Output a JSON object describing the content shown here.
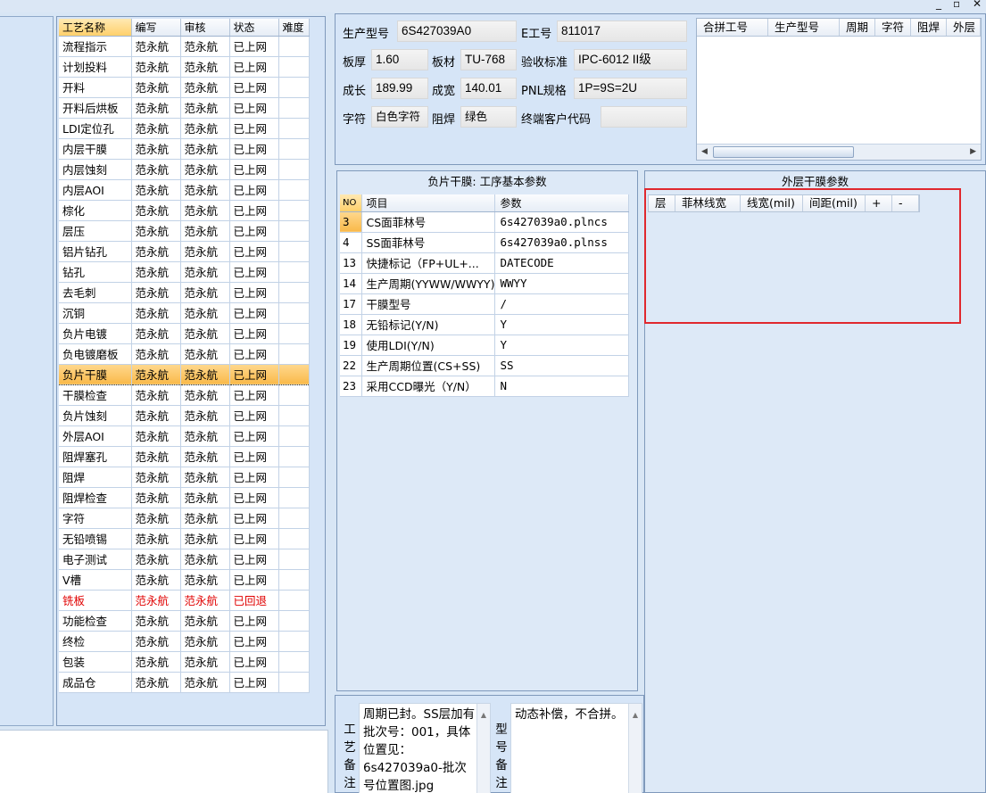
{
  "window_controls": {
    "minimize": "_",
    "restore": "▫",
    "close": "✕"
  },
  "process_list": {
    "headers": [
      "工艺名称",
      "编写",
      "审核",
      "状态",
      "难度"
    ],
    "rows": [
      [
        "流程指示",
        "范永航",
        "范永航",
        "已上网",
        ""
      ],
      [
        "计划投料",
        "范永航",
        "范永航",
        "已上网",
        ""
      ],
      [
        "开料",
        "范永航",
        "范永航",
        "已上网",
        ""
      ],
      [
        "开料后烘板",
        "范永航",
        "范永航",
        "已上网",
        ""
      ],
      [
        "LDI定位孔",
        "范永航",
        "范永航",
        "已上网",
        ""
      ],
      [
        "内层干膜",
        "范永航",
        "范永航",
        "已上网",
        ""
      ],
      [
        "内层蚀刻",
        "范永航",
        "范永航",
        "已上网",
        ""
      ],
      [
        "内层AOI",
        "范永航",
        "范永航",
        "已上网",
        ""
      ],
      [
        "棕化",
        "范永航",
        "范永航",
        "已上网",
        ""
      ],
      [
        "层压",
        "范永航",
        "范永航",
        "已上网",
        ""
      ],
      [
        "铝片钻孔",
        "范永航",
        "范永航",
        "已上网",
        ""
      ],
      [
        "钻孔",
        "范永航",
        "范永航",
        "已上网",
        ""
      ],
      [
        "去毛刺",
        "范永航",
        "范永航",
        "已上网",
        ""
      ],
      [
        "沉铜",
        "范永航",
        "范永航",
        "已上网",
        ""
      ],
      [
        "负片电镀",
        "范永航",
        "范永航",
        "已上网",
        ""
      ],
      [
        "负电镀磨板",
        "范永航",
        "范永航",
        "已上网",
        ""
      ],
      [
        "负片干膜",
        "范永航",
        "范永航",
        "已上网",
        ""
      ],
      [
        "干膜检查",
        "范永航",
        "范永航",
        "已上网",
        ""
      ],
      [
        "负片蚀刻",
        "范永航",
        "范永航",
        "已上网",
        ""
      ],
      [
        "外层AOI",
        "范永航",
        "范永航",
        "已上网",
        ""
      ],
      [
        "阻焊塞孔",
        "范永航",
        "范永航",
        "已上网",
        ""
      ],
      [
        "阻焊",
        "范永航",
        "范永航",
        "已上网",
        ""
      ],
      [
        "阻焊检查",
        "范永航",
        "范永航",
        "已上网",
        ""
      ],
      [
        "字符",
        "范永航",
        "范永航",
        "已上网",
        ""
      ],
      [
        "无铅喷锡",
        "范永航",
        "范永航",
        "已上网",
        ""
      ],
      [
        "电子测试",
        "范永航",
        "范永航",
        "已上网",
        ""
      ],
      [
        "V槽",
        "范永航",
        "范永航",
        "已上网",
        ""
      ],
      [
        "铣板",
        "范永航",
        "范永航",
        "已回退",
        ""
      ],
      [
        "功能检查",
        "范永航",
        "范永航",
        "已上网",
        ""
      ],
      [
        "终检",
        "范永航",
        "范永航",
        "已上网",
        ""
      ],
      [
        "包装",
        "范永航",
        "范永航",
        "已上网",
        ""
      ],
      [
        "成品仓",
        "范永航",
        "范永航",
        "已上网",
        ""
      ]
    ]
  },
  "info": {
    "model_label": "生产型号",
    "model_value": "6S427039A0",
    "e_label": "E工号",
    "e_value": "811017",
    "thickness_label": "板厚",
    "thickness_value": "1.60",
    "material_label": "板材",
    "material_value": "TU-768",
    "standard_label": "验收标准",
    "standard_value": "IPC-6012 II级",
    "length_label": "成长",
    "length_value": "189.99",
    "width_label": "成宽",
    "width_value": "140.01",
    "pnl_label": "PNL规格",
    "pnl_value": "1P=9S=2U",
    "char_label": "字符",
    "char_value": "白色字符",
    "mask_label": "阻焊",
    "mask_value": "绿色",
    "customer_label": "终端客户代码",
    "customer_value": ""
  },
  "combine_table": {
    "headers": [
      "合拼工号",
      "生产型号",
      "周期",
      "字符",
      "阻焊",
      "外层"
    ]
  },
  "params": {
    "title": "负片干膜: 工序基本参数",
    "headers": [
      "NO",
      "项目",
      "参数"
    ],
    "rows": [
      [
        "3",
        "CS面菲林号",
        "6s427039a0.plncs"
      ],
      [
        "4",
        "SS面菲林号",
        "6s427039a0.plnss"
      ],
      [
        "13",
        "快捷标记（FP+UL+...",
        "DATECODE"
      ],
      [
        "14",
        "生产周期(YYWW/WWYY)",
        "WWYY"
      ],
      [
        "17",
        "干膜型号",
        "/"
      ],
      [
        "18",
        "无铅标记(Y/N)",
        "Y"
      ],
      [
        "19",
        "使用LDI(Y/N)",
        "Y"
      ],
      [
        "22",
        "生产周期位置(CS+SS)",
        "SS"
      ],
      [
        "23",
        "采用CCD曝光（Y/N）",
        "N"
      ]
    ]
  },
  "outer": {
    "title": "外层干膜参数",
    "headers": [
      "层",
      "菲林线宽",
      "线宽(mil)",
      "间距(mil)",
      "+",
      "-"
    ]
  },
  "notes": {
    "process_label": [
      "工",
      "艺",
      "备",
      "注"
    ],
    "process_text": "周期已封。SS层加有批次号：001，具体位置见：6s427039a0-批次号位置图.jpg",
    "model_label": [
      "型",
      "号",
      "备",
      "注"
    ],
    "model_text": "动态补偿，不合拼。"
  },
  "colors": {
    "selection": "#f9b94a",
    "returned": "#e00000",
    "highlight_box": "#e0282e",
    "panel_bg": "#d6e5f7"
  }
}
